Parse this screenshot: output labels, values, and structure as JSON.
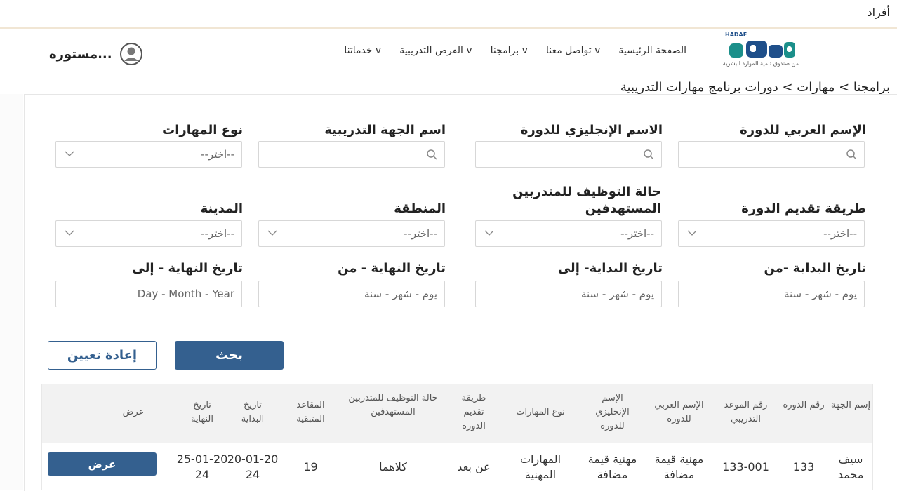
{
  "top_label": "أفراد",
  "logo": {
    "sub": "من صندوق تنمية الموارد البشرية",
    "mark": "هدف",
    "latin": "HADAF"
  },
  "nav": {
    "items": [
      "الصفحة الرئيسية",
      "تواصل معنا v",
      "برامجنا v",
      "الفرص التدريبية v",
      "خدماتنا v"
    ]
  },
  "user": {
    "name": "مستوره..."
  },
  "breadcrumb": "برامجنا > مهارات > دورات برنامج مهارات التدريبية",
  "filters": {
    "row1": [
      {
        "label": "الإسم العربي للدورة",
        "type": "search",
        "value": ""
      },
      {
        "label": "الاسم الإنجليزي للدورة",
        "type": "search",
        "value": ""
      },
      {
        "label": "اسم الجهة التدريبية",
        "type": "search",
        "value": ""
      },
      {
        "label": "نوع المهارات",
        "type": "select",
        "value": "--اختر--"
      }
    ],
    "row2": [
      {
        "label": "طريقة تقديم الدورة",
        "type": "select",
        "value": "--اختر--"
      },
      {
        "label": "حالة التوظيف للمتدربين المستهدفين",
        "type": "select",
        "value": "--اختر--"
      },
      {
        "label": "المنطقة",
        "type": "select",
        "value": "--اختر--"
      },
      {
        "label": "المدينة",
        "type": "select",
        "value": "--اختر--"
      }
    ],
    "row3": [
      {
        "label": "تاريخ البداية -من",
        "type": "date",
        "placeholder": "يوم - شهر - سنة"
      },
      {
        "label": "تاريخ البداية- إلى",
        "type": "date",
        "placeholder": "يوم - شهر - سنة"
      },
      {
        "label": "تاريخ النهاية - من",
        "type": "date",
        "placeholder": "يوم - شهر - سنة"
      },
      {
        "label": "تاريخ النهاية - إلى",
        "type": "date",
        "placeholder": "Day - Month - Year"
      }
    ]
  },
  "buttons": {
    "search": "بحث",
    "reset": "إعادة تعيين"
  },
  "table": {
    "headers": [
      "إسم الجهة",
      "رقم الدورة",
      "رقم الموعد التدريبي",
      "الإسم العربي للدورة",
      "الإسم الإنجليزي للدورة",
      "نوع المهارات",
      "طريقة تقديم الدورة",
      "حالة التوظيف للمتدربين المستهدفين",
      "المقاعد المتبقية",
      "تاريخ البداية",
      "تاريخ النهاية",
      "عرض"
    ],
    "rows": [
      [
        "سيف محمد",
        "133",
        "133-001",
        "مهنية قيمة مضافة",
        "مهنية قيمة مضافة",
        "المهارات المهنية",
        "عن بعد",
        "كلاهما",
        "19",
        "20-01-2024",
        "25-01-2024",
        "عرض"
      ]
    ]
  },
  "colors": {
    "primary": "#34608f",
    "logo_teal": "#1b8f8a",
    "logo_blue": "#1f4f8a"
  }
}
